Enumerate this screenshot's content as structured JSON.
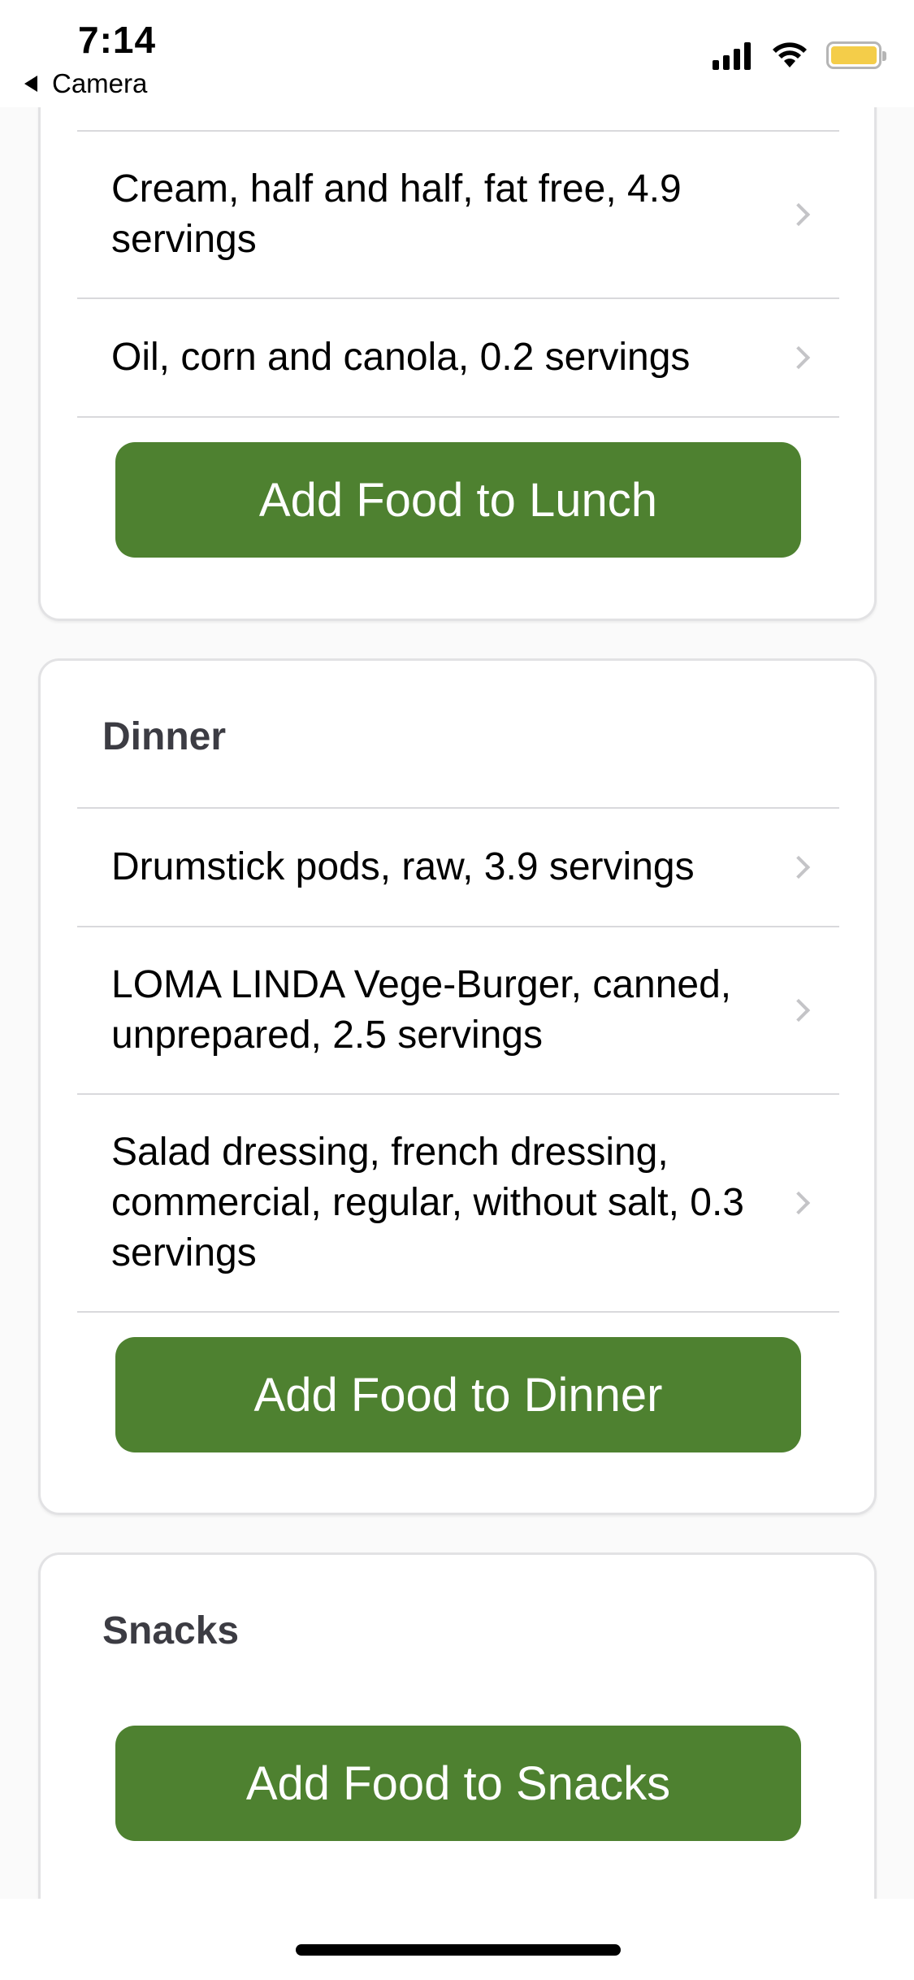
{
  "status_bar": {
    "time": "7:14",
    "back_app_label": "Camera",
    "battery_color": "#f4cd49"
  },
  "lunch": {
    "items": [
      {
        "label": "Cream, half and half, fat free, 4.9 servings"
      },
      {
        "label": "Oil, corn and canola, 0.2 servings"
      }
    ],
    "add_button_label": "Add Food to Lunch"
  },
  "dinner": {
    "title": "Dinner",
    "items": [
      {
        "label": "Drumstick pods, raw, 3.9 servings"
      },
      {
        "label": "LOMA LINDA Vege-Burger, canned, unprepared, 2.5 servings"
      },
      {
        "label": "Salad dressing, french dressing, commercial, regular, without salt, 0.3 servings"
      }
    ],
    "add_button_label": "Add Food to Dinner"
  },
  "snacks": {
    "title": "Snacks",
    "items": [],
    "add_button_label": "Add Food to Snacks"
  },
  "colors": {
    "accent_green": "#4e8130",
    "section_title": "#3c3c43"
  },
  "icons": {
    "row_disclosure": "chevron-right-icon",
    "back": "back-triangle-icon"
  }
}
